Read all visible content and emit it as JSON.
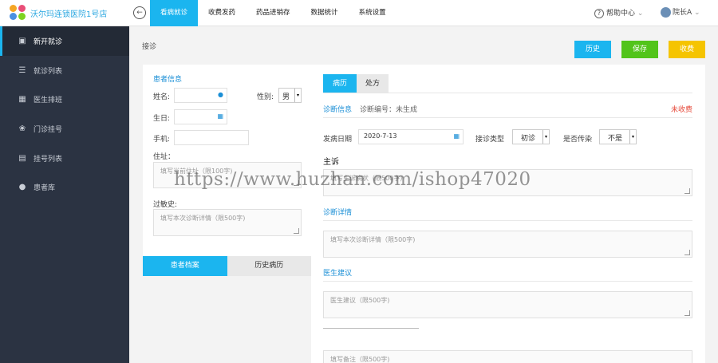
{
  "header": {
    "brand": "沃尔玛连锁医院1号店",
    "back_icon": "arrow-left-icon",
    "nav": [
      {
        "label": "看病就诊",
        "active": true
      },
      {
        "label": "收费发药",
        "active": false
      },
      {
        "label": "药品进销存",
        "active": false
      },
      {
        "label": "数据统计",
        "active": false
      },
      {
        "label": "系统设置",
        "active": false
      }
    ],
    "help": "帮助中心",
    "user": "院长A"
  },
  "sidebar": {
    "items": [
      {
        "label": "新开就诊",
        "icon": "medical-kit-icon",
        "active": true
      },
      {
        "label": "就诊列表",
        "icon": "list-icon",
        "active": false
      },
      {
        "label": "医生排班",
        "icon": "calendar-icon",
        "active": false
      },
      {
        "label": "门诊挂号",
        "icon": "stethoscope-icon",
        "active": false
      },
      {
        "label": "挂号列表",
        "icon": "table-icon",
        "active": false
      },
      {
        "label": "患者库",
        "icon": "user-icon",
        "active": false
      }
    ]
  },
  "page": {
    "breadcrumb": "接诊",
    "buttons": {
      "history": "历史",
      "save": "保存",
      "charge": "收费"
    },
    "colors": {
      "history": "#1bb5ef",
      "save": "#52c41a",
      "charge": "#f5c400",
      "accent": "#1bb5ef"
    }
  },
  "patient": {
    "title": "患者信息",
    "name_label": "姓名:",
    "gender_label": "性别:",
    "gender_value": "男",
    "birthday_label": "生日:",
    "phone_label": "手机:",
    "address_label": "住址：",
    "address_placeholder": "填写当前住址（限100字)",
    "allergy_label": "过敏史:",
    "allergy_placeholder": "填写本次诊断详情（限500字)",
    "tabs": [
      "患者档案",
      "历史病历"
    ]
  },
  "record": {
    "tabs": [
      "病历",
      "处方"
    ],
    "diag_info_label": "诊断信息",
    "diag_no_label": "诊断编号：未生成",
    "status": "未收费",
    "onset_label": "发病日期",
    "onset_value": "2020-7-13",
    "visit_type_label": "接诊类型",
    "visit_type_value": "初诊",
    "contagious_label": "是否传染",
    "contagious_value": "不是",
    "complaint_label": "主诉",
    "complaint_placeholder": "填写主诉病状（限500字)",
    "detail_label": "诊断详情",
    "detail_placeholder": "填写本次诊断详情（限500字)",
    "advice_label": "医生建议",
    "advice_placeholder": "医生建议（限500字)",
    "remark_placeholder": "填写备注（限500字)"
  },
  "watermark": "https://www.huzhan.com/ishop47020"
}
